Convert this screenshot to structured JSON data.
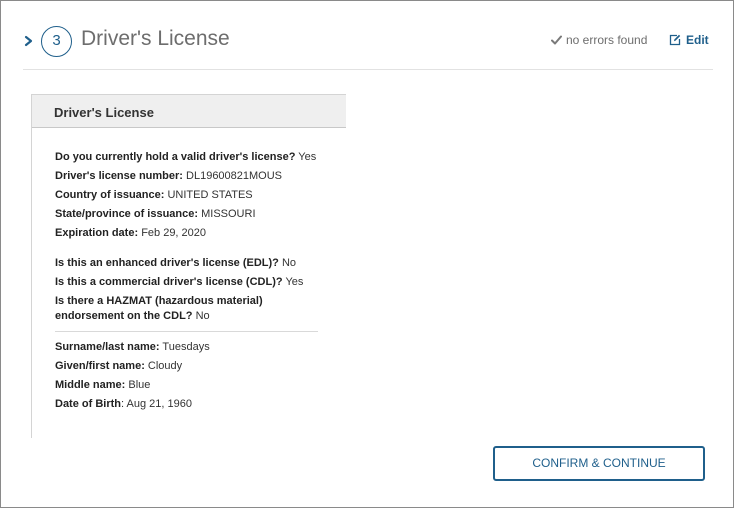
{
  "step": {
    "number": "3",
    "title": "Driver's License",
    "status_text": "no errors found",
    "edit_label": "Edit"
  },
  "card": {
    "title": "Driver's License",
    "fields": [
      {
        "label": "Do you currently hold a valid driver's license?",
        "value": "Yes"
      },
      {
        "label": "Driver's license number:",
        "value": "DL19600821MOUS"
      },
      {
        "label": "Country of issuance:",
        "value": "UNITED STATES"
      },
      {
        "label": "State/province of issuance:",
        "value": "MISSOURI"
      },
      {
        "label": "Expiration date:",
        "value": "Feb 29, 2020"
      },
      {
        "label": "Is this an enhanced driver's license (EDL)?",
        "value": "No"
      },
      {
        "label": "Is this a commercial driver's license (CDL)?",
        "value": "Yes"
      },
      {
        "label": "Is there a HAZMAT (hazardous material) endorsement on the CDL?",
        "value": "No"
      },
      {
        "label": "Surname/last name:",
        "value": "Tuesdays"
      },
      {
        "label": "Given/first name:",
        "value": "Cloudy"
      },
      {
        "label": "Middle name:",
        "value": "Blue"
      },
      {
        "label": "Date of Birth",
        "value": ": Aug 21, 1960"
      }
    ]
  },
  "confirm_button": "CONFIRM & CONTINUE",
  "colors": {
    "accent": "#1f5f8b",
    "header_bg": "#efefef",
    "muted_text": "#6d6d6d"
  }
}
